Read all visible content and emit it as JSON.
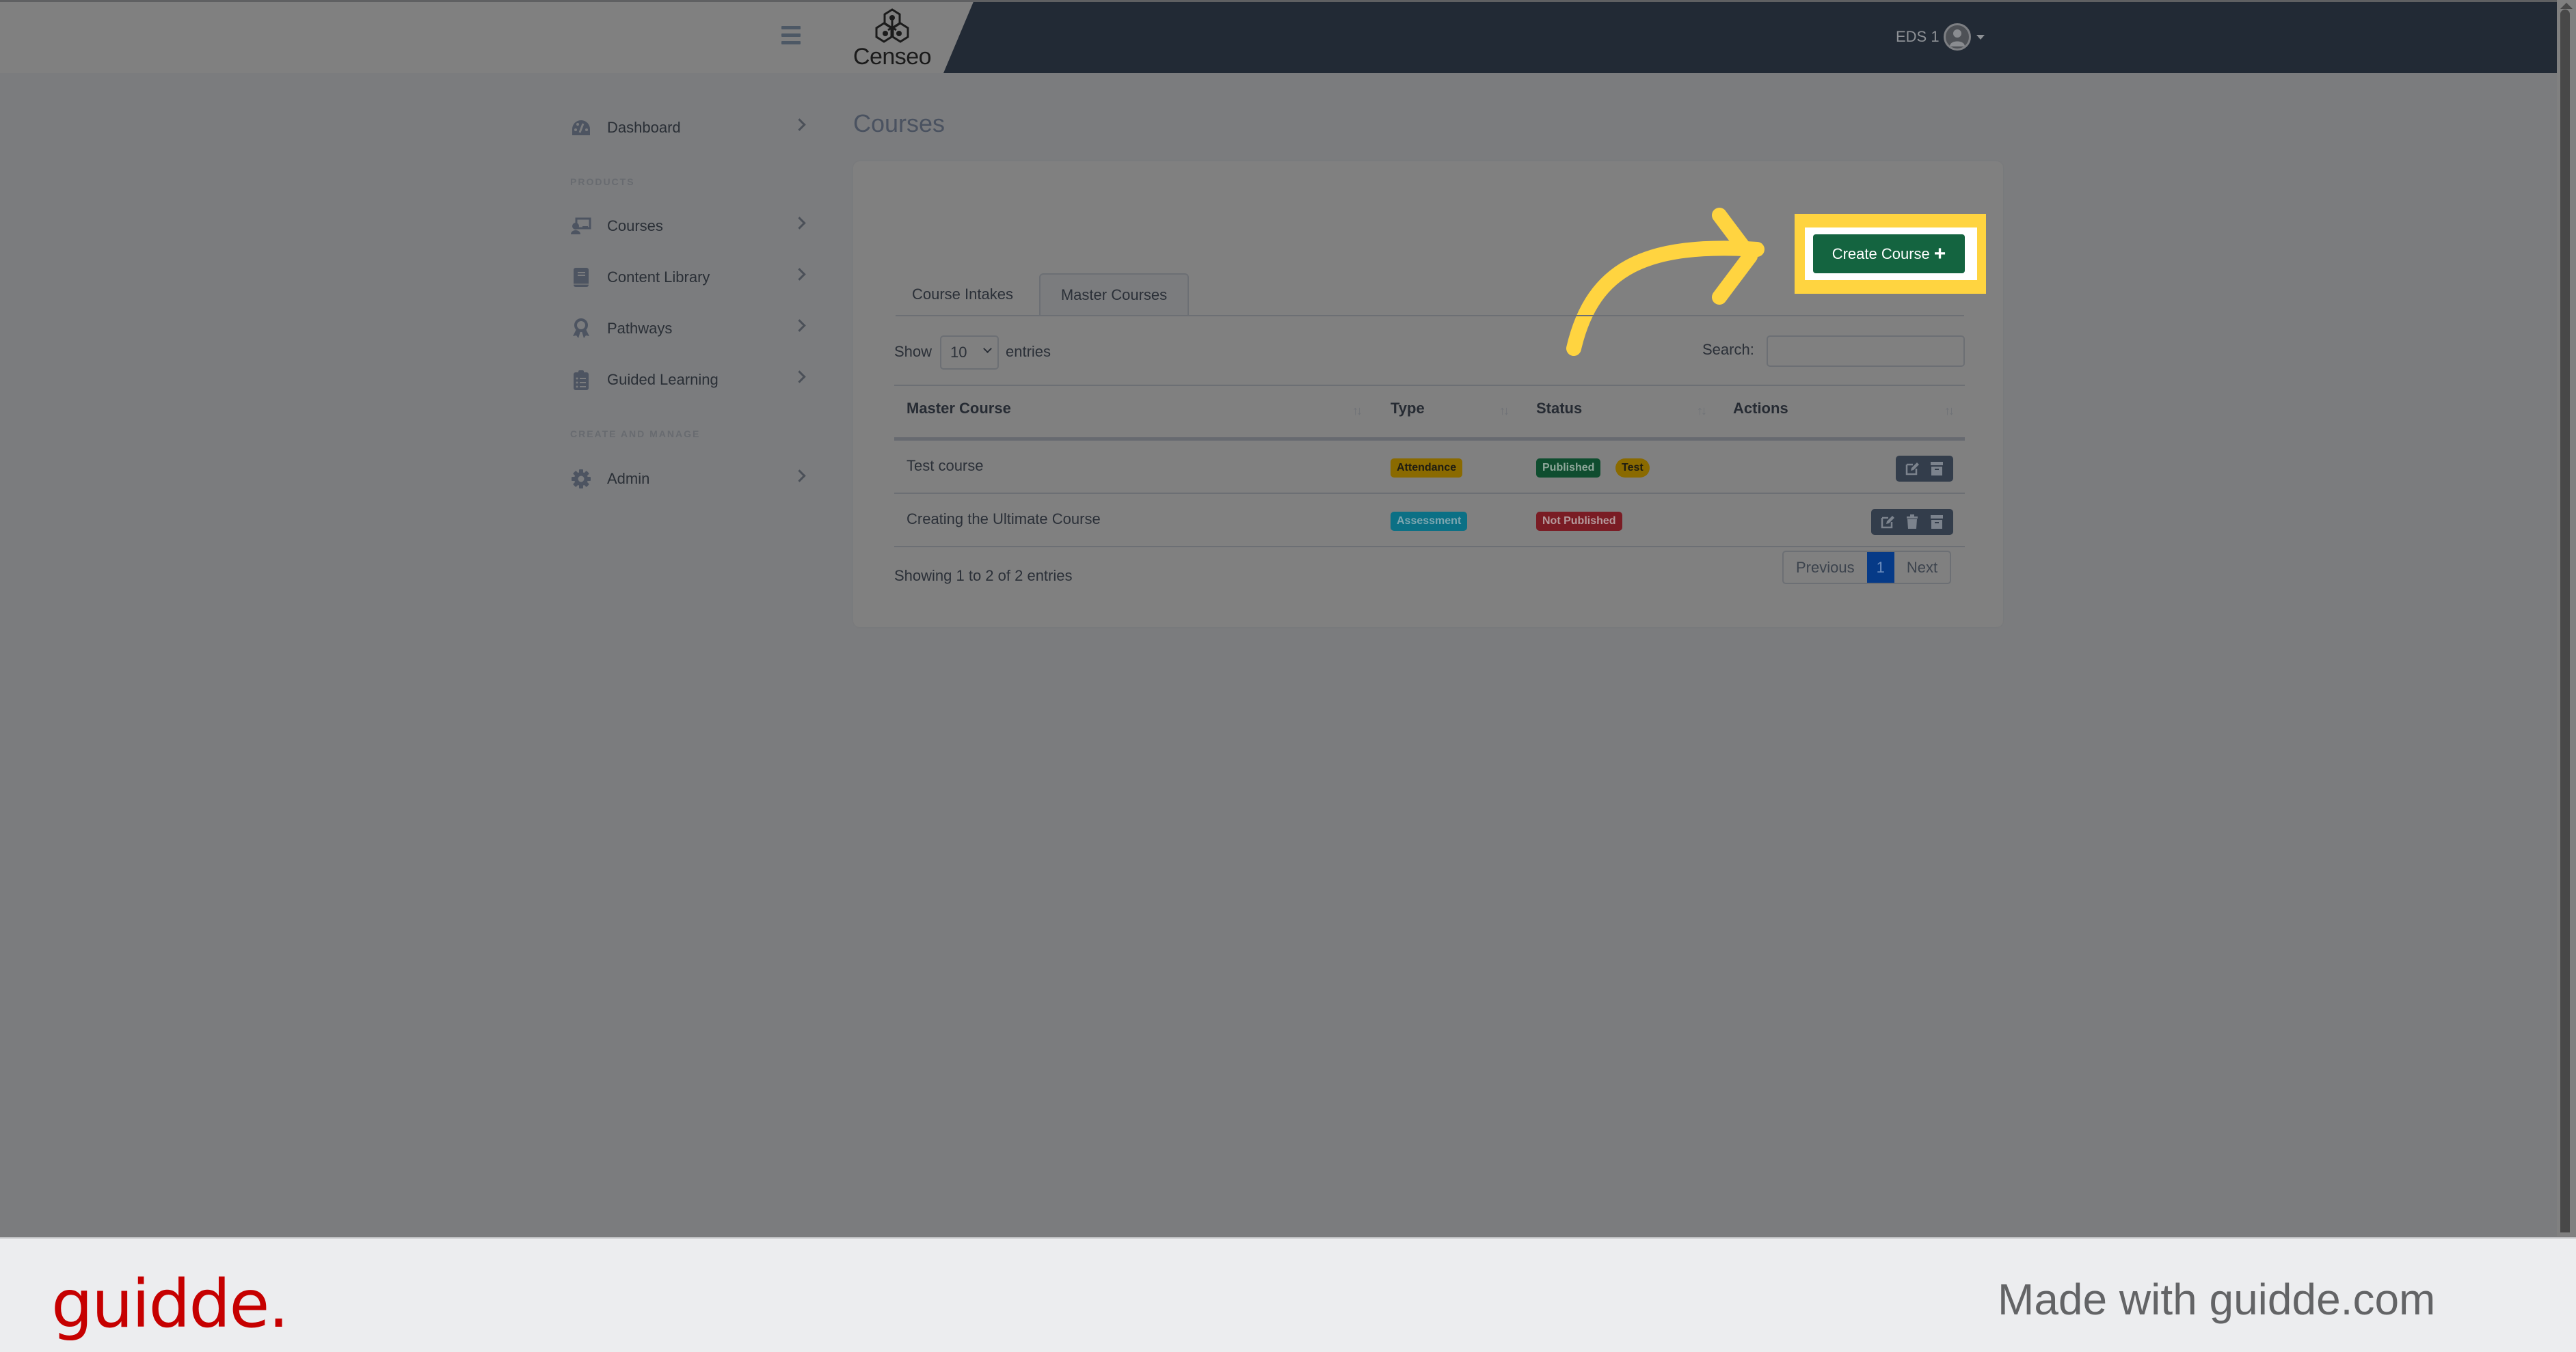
{
  "header": {
    "brand": "Censeo",
    "menu_icon": "hamburger-icon",
    "user": {
      "name": "EDS 1",
      "avatar_icon": "user-avatar-icon",
      "dropdown_icon": "caret-down-icon"
    }
  },
  "sidebar": {
    "items": [
      {
        "label": "Dashboard",
        "icon": "dashboard-gauge-icon"
      },
      {
        "section": "PRODUCTS"
      },
      {
        "label": "Courses",
        "icon": "chalkboard-teacher-icon"
      },
      {
        "label": "Content Library",
        "icon": "book-icon"
      },
      {
        "label": "Pathways",
        "icon": "award-icon"
      },
      {
        "label": "Guided Learning",
        "icon": "clipboard-list-icon"
      },
      {
        "section": "CREATE AND MANAGE"
      },
      {
        "label": "Admin",
        "icon": "gear-icon"
      }
    ]
  },
  "main": {
    "title": "Courses",
    "create_button": {
      "label": "Create Course",
      "icon": "plus-icon",
      "color": "#146440"
    },
    "highlight_color": "#ffd440",
    "tabs": [
      {
        "label": "Course Intakes",
        "active": false
      },
      {
        "label": "Master Courses",
        "active": true
      }
    ],
    "length_control": {
      "prefix": "Show",
      "value": "10",
      "suffix": "entries"
    },
    "search": {
      "label": "Search:",
      "value": "",
      "placeholder": ""
    },
    "table": {
      "columns": [
        "Master Course",
        "Type",
        "Status",
        "Actions"
      ],
      "rows": [
        {
          "name": "Test course",
          "type": {
            "label": "Attendance",
            "color": "#8a6a00"
          },
          "status": [
            {
              "label": "Published",
              "color": "#0f4d2f"
            },
            {
              "label": "Test",
              "color": "#8a6a00"
            }
          ],
          "actions": [
            "edit-icon",
            "archive-icon"
          ]
        },
        {
          "name": "Creating the Ultimate Course",
          "type": {
            "label": "Assessment",
            "color": "#0b7085"
          },
          "status": [
            {
              "label": "Not Published",
              "color": "#7a1c24"
            }
          ],
          "actions": [
            "edit-icon",
            "trash-icon",
            "archive-icon"
          ]
        }
      ]
    },
    "info": "Showing 1 to 2 of 2 entries",
    "pagination": {
      "previous": "Previous",
      "current": "1",
      "next": "Next"
    }
  },
  "footer": {
    "logo": "guidde.",
    "tagline": "Made with guidde.com",
    "logo_color": "#c60000"
  }
}
